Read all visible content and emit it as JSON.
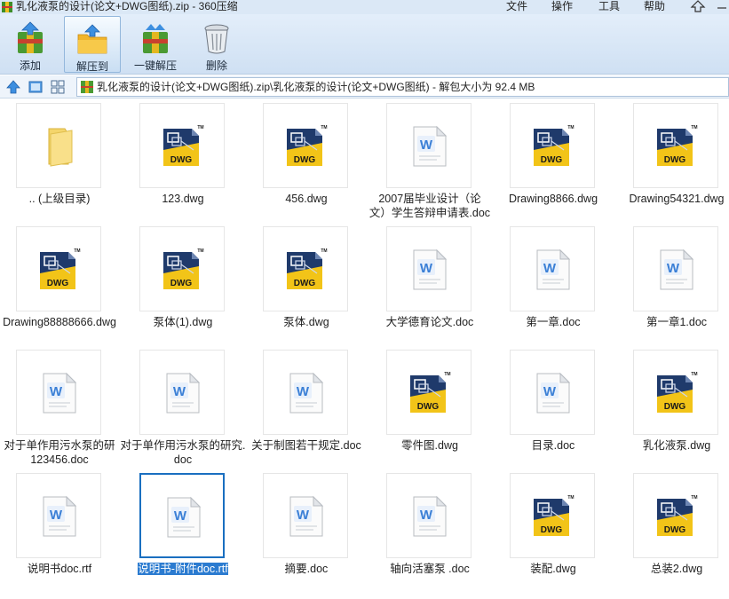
{
  "window": {
    "title": "乳化液泵的设计(论文+DWG图纸).zip - 360压缩"
  },
  "menu": [
    "文件",
    "操作",
    "工具",
    "帮助"
  ],
  "toolbar": {
    "buttons": [
      {
        "label": "添加",
        "icon": "add-archive-icon"
      },
      {
        "label": "解压到",
        "icon": "extract-to-icon"
      },
      {
        "label": "一键解压",
        "icon": "one-click-extract-icon"
      },
      {
        "label": "删除",
        "icon": "trash-icon"
      }
    ]
  },
  "addressbar": {
    "path": "乳化液泵的设计(论文+DWG图纸).zip\\乳化液泵的设计(论文+DWG图纸) - 解包大小为 92.4 MB"
  },
  "files": [
    {
      "name": ".. (上级目录)",
      "type": "folder"
    },
    {
      "name": "123.dwg",
      "type": "dwg"
    },
    {
      "name": "456.dwg",
      "type": "dwg"
    },
    {
      "name": "2007届毕业设计（论文）学生答辩申请表.doc",
      "type": "doc",
      "line1": "2007届毕业设计（论",
      "line2": "文）学生答辩申请表.doc"
    },
    {
      "name": "Drawing8866.dwg",
      "type": "dwg"
    },
    {
      "name": "Drawing54321.dwg",
      "type": "dwg"
    },
    {
      "name": "Drawing88888666.dwg",
      "type": "dwg"
    },
    {
      "name": "泵体(1).dwg",
      "type": "dwg"
    },
    {
      "name": "泵体.dwg",
      "type": "dwg"
    },
    {
      "name": "大学德育论文.doc",
      "type": "doc"
    },
    {
      "name": "第一章.doc",
      "type": "doc"
    },
    {
      "name": "第一章1.doc",
      "type": "doc"
    },
    {
      "name": "对于单作用污水泵的研123456.doc",
      "type": "doc",
      "line1": "对于单作用污水泵的研",
      "line2": "123456.doc"
    },
    {
      "name": "对于单作用污水泵的研究.doc",
      "type": "doc",
      "line1": "对于单作用污水泵的研究.",
      "line2": "doc"
    },
    {
      "name": "关于制图若干规定.doc",
      "type": "doc"
    },
    {
      "name": "零件图.dwg",
      "type": "dwg"
    },
    {
      "name": "目录.doc",
      "type": "doc"
    },
    {
      "name": "乳化液泵.dwg",
      "type": "dwg"
    },
    {
      "name": "说明书doc.rtf",
      "type": "doc"
    },
    {
      "name": "说明书-附件doc.rtf",
      "type": "doc",
      "selected": true
    },
    {
      "name": "摘要.doc",
      "type": "doc"
    },
    {
      "name": "轴向活塞泵 .doc",
      "type": "doc"
    },
    {
      "name": "装配.dwg",
      "type": "dwg"
    },
    {
      "name": "总装2.dwg",
      "type": "dwg"
    }
  ],
  "icons": {
    "dwg_label": "DWG",
    "doc_label": "W",
    "tm_label": "TM"
  },
  "colors": {
    "selection": "#2b7bd0",
    "dwg_yellow": "#f2c418",
    "dwg_navy": "#1f3a6b",
    "doc_blue": "#3a7fd6"
  }
}
